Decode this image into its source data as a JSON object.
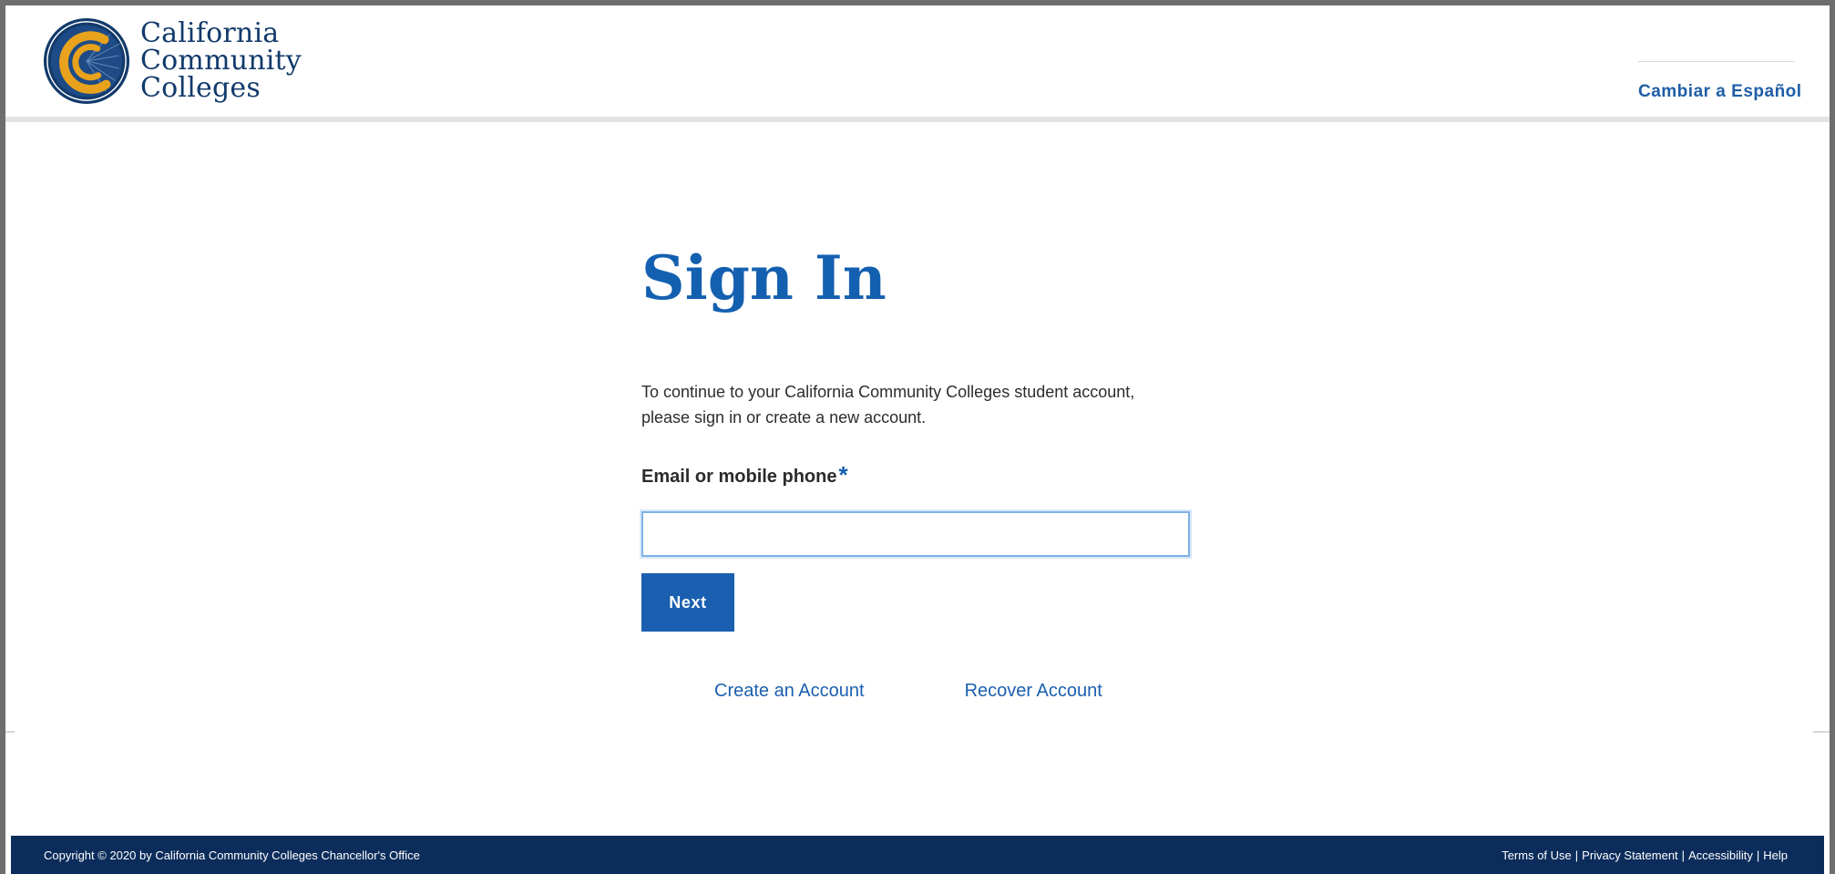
{
  "header": {
    "logo": {
      "line1": "California",
      "line2": "Community",
      "line3": "Colleges",
      "icon": "ccc-seal-icon",
      "colors": {
        "navy": "#123a6b",
        "gold": "#e8a21b"
      }
    },
    "language_toggle": "Cambiar a Español"
  },
  "main": {
    "title": "Sign In",
    "intro_line1": "To continue to your California Community Colleges student account,",
    "intro_line2": "please sign in or create a new account.",
    "field": {
      "label": "Email or mobile phone",
      "required_mark": "*",
      "value": "",
      "placeholder": ""
    },
    "next_button": "Next",
    "links": {
      "create_account": "Create an Account",
      "recover_account": "Recover Account"
    }
  },
  "footer": {
    "copyright": "Copyright © 2020 by California Community Colleges Chancellor's Office",
    "links": [
      "Terms of Use",
      "Privacy Statement",
      "Accessibility",
      "Help"
    ],
    "separator": "|"
  },
  "colors": {
    "primary_blue": "#1460b0",
    "button_blue": "#1a5fb0",
    "footer_navy": "#0c2d5c",
    "input_focus_border": "#7fb2e6"
  }
}
